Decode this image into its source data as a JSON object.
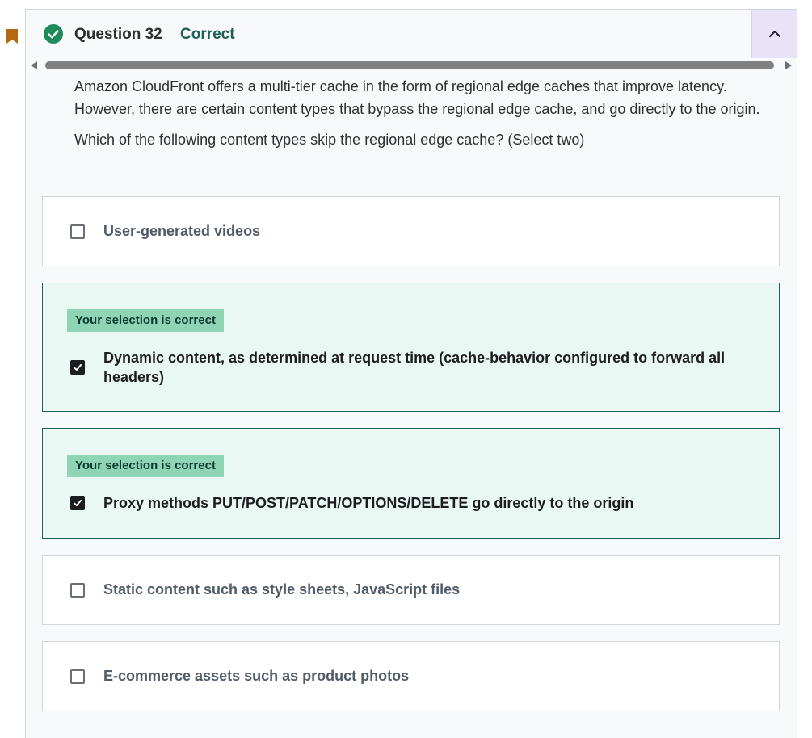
{
  "colors": {
    "correct_green": "#1e6055",
    "badge_bg": "#8fd5b5",
    "correct_option_bg": "#e9f8f3",
    "bookmark": "#b4690e",
    "collapse_bg": "#e8e3f8"
  },
  "header": {
    "title": "Question 32",
    "status": "Correct",
    "status_icon": "check-circle-icon",
    "collapse_icon": "chevron-up-icon",
    "bookmark_icon": "bookmark-icon"
  },
  "question": {
    "paragraph": "Amazon CloudFront offers a multi-tier cache in the form of regional edge caches that improve latency. However, there are certain content types that bypass the regional edge cache, and go directly to the origin.",
    "instruction": "Which of the following content types skip the regional edge cache? (Select two)"
  },
  "options": [
    {
      "label": "User-generated videos",
      "checked": false,
      "badge": ""
    },
    {
      "label": "Dynamic content, as determined at request time (cache-behavior configured to forward all headers)",
      "checked": true,
      "badge": "Your selection is correct"
    },
    {
      "label": "Proxy methods PUT/POST/PATCH/OPTIONS/DELETE go directly to the origin",
      "checked": true,
      "badge": "Your selection is correct"
    },
    {
      "label": "Static content such as style sheets, JavaScript files",
      "checked": false,
      "badge": ""
    },
    {
      "label": "E-commerce assets such as product photos",
      "checked": false,
      "badge": ""
    }
  ]
}
